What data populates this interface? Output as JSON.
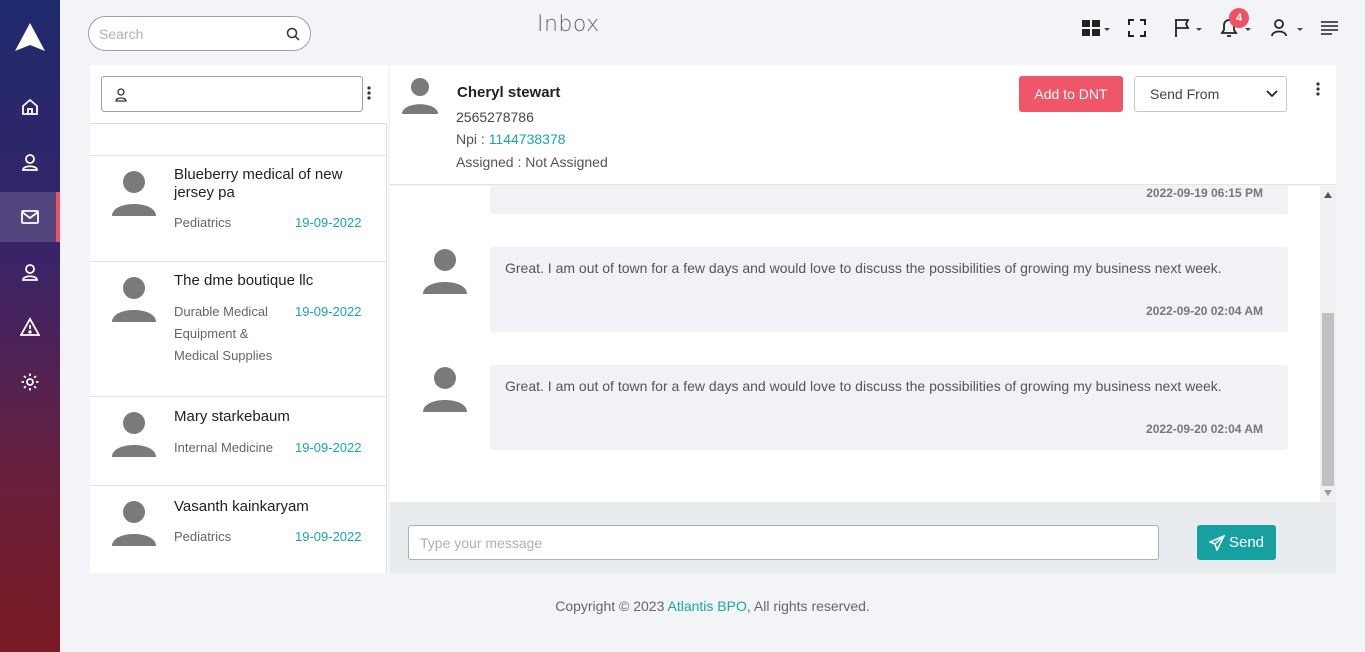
{
  "header": {
    "search_placeholder": "Search",
    "title": "Inbox",
    "notification_count": "4"
  },
  "sidebar": {
    "items": [
      {
        "name": "home",
        "active": false
      },
      {
        "name": "contacts",
        "active": false
      },
      {
        "name": "inbox",
        "active": true
      },
      {
        "name": "users",
        "active": false
      },
      {
        "name": "alerts",
        "active": false
      },
      {
        "name": "settings",
        "active": false
      }
    ]
  },
  "contacts": [
    {
      "name": "Blueberry medical of new jersey pa",
      "specialty": "Pediatrics",
      "date": "19-09-2022"
    },
    {
      "name": "The dme boutique llc",
      "specialty": "Durable Medical Equipment & Medical Supplies",
      "date": "19-09-2022"
    },
    {
      "name": "Mary starkebaum",
      "specialty": "Internal Medicine",
      "date": "19-09-2022"
    },
    {
      "name": "Vasanth kainkaryam",
      "specialty": "Pediatrics",
      "date": "19-09-2022"
    }
  ],
  "chat": {
    "contact_name": "Cheryl stewart",
    "phone": "2565278786",
    "npi_label": "Npi : ",
    "npi_value": "1144738378",
    "assigned": "Assigned : Not Assigned",
    "add_dnt_label": "Add to DNT",
    "send_from_label": "Send From",
    "messages": [
      {
        "text": "",
        "time": "2022-09-19 06:15 PM"
      },
      {
        "text": "Great. I am out of town for a few days and would love to discuss the possibilities of growing my business next week.",
        "time": "2022-09-20 02:04 AM"
      },
      {
        "text": "Great. I am out of town for a few days and would love to discuss the possibilities of growing my business next week.",
        "time": "2022-09-20 02:04 AM"
      }
    ],
    "compose_placeholder": "Type your message",
    "send_label": "Send"
  },
  "footer": {
    "prefix": "Copyright © 2023 ",
    "brand": "Atlantis BPO",
    "suffix": ", All rights reserved."
  }
}
